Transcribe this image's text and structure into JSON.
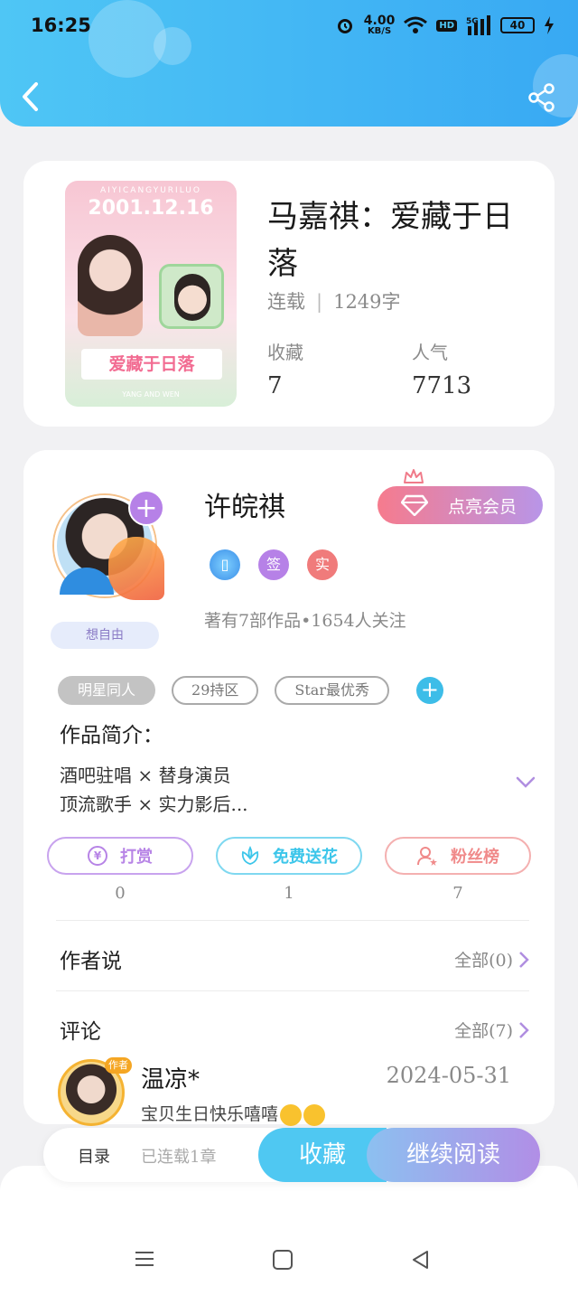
{
  "status_bar": {
    "time": "16:25",
    "net_speed": "4.00",
    "net_unit": "KB/S",
    "hd": "HD",
    "signal": "5G",
    "battery": "40"
  },
  "book": {
    "cover": {
      "top_text": "AIYICANGYURILUO",
      "date": "2001.12.16",
      "title": "爱藏于日落",
      "bottom_text": "YANG AND WEN"
    },
    "title": "马嘉祺：爱藏于日落",
    "status": "连载",
    "word_count": "1249字",
    "collect_label": "收藏",
    "collect_value": "7",
    "popularity_label": "人气",
    "popularity_value": "7713"
  },
  "author": {
    "name": "许皖祺",
    "vip_button": "点亮会员",
    "free_tag": "想自由",
    "badges": [
      "签",
      "实"
    ],
    "stats": "著有7部作品•1654人关注",
    "tags": [
      "明星同人",
      "29持区",
      "Star最优秀"
    ],
    "intro_label": "作品简介：",
    "intro_lines": [
      "酒吧驻唱 × 替身演员",
      "顶流歌手 × 实力影后..."
    ]
  },
  "actions": [
    {
      "label": "打赏",
      "icon": "yen-icon",
      "count": "0",
      "color": "#b784e6"
    },
    {
      "label": "免费送花",
      "icon": "flower-icon",
      "count": "1",
      "color": "#3cc6ea"
    },
    {
      "label": "粉丝榜",
      "icon": "fan-icon",
      "count": "7",
      "color": "#f08a8a"
    }
  ],
  "author_says": {
    "label": "作者说",
    "more": "全部(0)"
  },
  "comments": {
    "label": "评论",
    "more": "全部(7)",
    "items": [
      {
        "tag": "作者",
        "name": "温凉*",
        "date": "2024-05-31",
        "text": "宝贝生日快乐嘻嘻"
      }
    ]
  },
  "bottom_bar": {
    "catalog": "目录",
    "progress": "已连载1章",
    "collect": "收藏",
    "read": "继续阅读"
  }
}
